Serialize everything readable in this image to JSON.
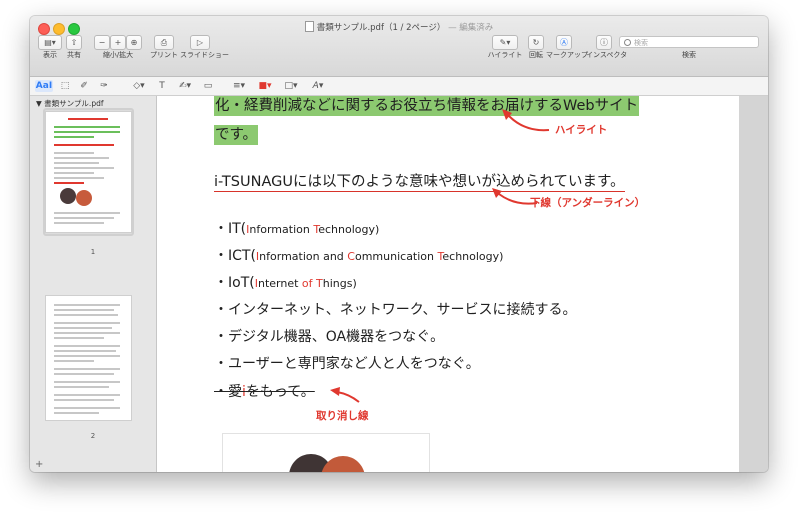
{
  "window": {
    "title": "書類サンプル.pdf（1 / 2ページ）",
    "edited": "— 編集済み"
  },
  "toolbar": {
    "view_label": "表示",
    "share_label": "共有",
    "zoom_label": "縮小/拡大",
    "print_label": "プリント",
    "slideshow_label": "スライドショー",
    "highlight_label": "ハイライト",
    "rotate_label": "回転",
    "markup_label": "マークアップ",
    "inspector_label": "インスペクタ",
    "search_label": "検索",
    "search_placeholder": "検索",
    "text_tool": "AaI",
    "font_tool": "A"
  },
  "sidebar": {
    "file_label": "書類サンプル.pdf",
    "pages": [
      {
        "number": "1"
      },
      {
        "number": "2"
      }
    ],
    "add_label": "+"
  },
  "document": {
    "line1": "化・経費削減などに関するお役立ち情報をお届けするWebサイト",
    "line2": "です。",
    "line3": "i-TSUNAGUには以下のような意味や想いが込められています。",
    "bullets": [
      {
        "prefix": "・IT(",
        "parts": [
          [
            "I",
            "r"
          ],
          [
            "nformation ",
            ""
          ],
          [
            "T",
            "r"
          ],
          [
            "echnology)",
            ""
          ]
        ]
      },
      {
        "prefix": "・ICT(",
        "parts": [
          [
            "I",
            "r"
          ],
          [
            "nformation and ",
            ""
          ],
          [
            "C",
            "r"
          ],
          [
            "ommunication ",
            ""
          ],
          [
            "T",
            "r"
          ],
          [
            "echnology)",
            ""
          ]
        ]
      },
      {
        "prefix": "・IoT(",
        "parts": [
          [
            "I",
            "r"
          ],
          [
            "nternet ",
            ""
          ],
          [
            "of ",
            "r"
          ],
          [
            "T",
            "r"
          ],
          [
            "hings)",
            ""
          ]
        ]
      }
    ],
    "jp_bullets": [
      "・インターネット、ネットワーク、サービスに接続する。",
      "・デジタル機器、OA機器をつなぐ。",
      "・ユーザーと専門家など人と人をつなぐ。"
    ],
    "strike_prefix": "・愛",
    "strike_red": "i",
    "strike_suffix": "をもって。"
  },
  "annotations": {
    "highlight": "ハイライト",
    "underline": "下線（アンダーライン）",
    "strikethrough": "取り消し線"
  },
  "colors": {
    "highlight": "#8cc970",
    "annotation_red": "#e0382f"
  }
}
